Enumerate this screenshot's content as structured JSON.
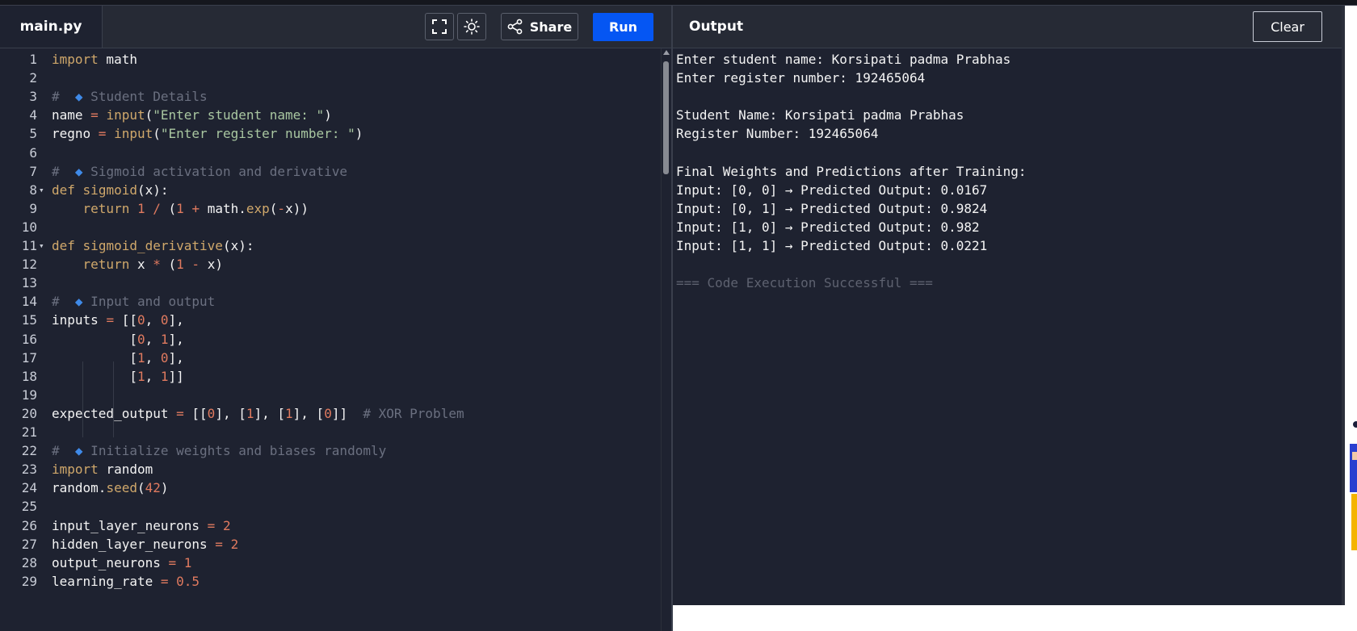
{
  "editor": {
    "file_tab": "main.py",
    "share_label": "Share",
    "run_label": "Run",
    "lines": [
      {
        "n": "1",
        "fold": "",
        "html": "<span class=\"kw\">import</span> math"
      },
      {
        "n": "2",
        "fold": "",
        "html": ""
      },
      {
        "n": "3",
        "fold": "",
        "html": "<span class=\"cm\">#  <span class=\"dia\">◆</span> Student Details</span>"
      },
      {
        "n": "4",
        "fold": "",
        "html": "name <span class=\"op\">=</span> <span class=\"fn\">input</span>(<span class=\"str\">\"Enter student name: \"</span>)"
      },
      {
        "n": "5",
        "fold": "",
        "html": "regno <span class=\"op\">=</span> <span class=\"fn\">input</span>(<span class=\"str\">\"Enter register number: \"</span>)"
      },
      {
        "n": "6",
        "fold": "",
        "html": ""
      },
      {
        "n": "7",
        "fold": "",
        "html": "<span class=\"cm\">#  <span class=\"dia\">◆</span> Sigmoid activation and derivative</span>"
      },
      {
        "n": "8",
        "fold": "▾",
        "html": "<span class=\"kw\">def</span> <span class=\"fn\">sigmoid</span>(x):"
      },
      {
        "n": "9",
        "fold": "",
        "html": "    <span class=\"kw\">return</span> <span class=\"num\">1</span> <span class=\"op\">/</span> (<span class=\"num\">1</span> <span class=\"op\">+</span> math.<span class=\"fn\">exp</span>(<span class=\"op\">-</span>x))"
      },
      {
        "n": "10",
        "fold": "",
        "html": ""
      },
      {
        "n": "11",
        "fold": "▾",
        "html": "<span class=\"kw\">def</span> <span class=\"fn\">sigmoid_derivative</span>(x):"
      },
      {
        "n": "12",
        "fold": "",
        "html": "    <span class=\"kw\">return</span> x <span class=\"op\">*</span> (<span class=\"num\">1</span> <span class=\"op\">-</span> x)"
      },
      {
        "n": "13",
        "fold": "",
        "html": ""
      },
      {
        "n": "14",
        "fold": "",
        "html": "<span class=\"cm\">#  <span class=\"dia\">◆</span> Input and output</span>"
      },
      {
        "n": "15",
        "fold": "",
        "html": "inputs <span class=\"op\">=</span> [[<span class=\"num\">0</span>, <span class=\"num\">0</span>],"
      },
      {
        "n": "16",
        "fold": "",
        "html": "          [<span class=\"num\">0</span>, <span class=\"num\">1</span>],"
      },
      {
        "n": "17",
        "fold": "",
        "html": "          [<span class=\"num\">1</span>, <span class=\"num\">0</span>],"
      },
      {
        "n": "18",
        "fold": "",
        "html": "          [<span class=\"num\">1</span>, <span class=\"num\">1</span>]]"
      },
      {
        "n": "19",
        "fold": "",
        "html": ""
      },
      {
        "n": "20",
        "fold": "",
        "html": "expected_output <span class=\"op\">=</span> [[<span class=\"num\">0</span>], [<span class=\"num\">1</span>], [<span class=\"num\">1</span>], [<span class=\"num\">0</span>]]  <span class=\"cm\"># XOR Problem</span>"
      },
      {
        "n": "21",
        "fold": "",
        "html": ""
      },
      {
        "n": "22",
        "fold": "",
        "html": "<span class=\"cm\">#  <span class=\"dia\">◆</span> Initialize weights and biases randomly</span>"
      },
      {
        "n": "23",
        "fold": "",
        "html": "<span class=\"kw\">import</span> random"
      },
      {
        "n": "24",
        "fold": "",
        "html": "random.<span class=\"fn\">seed</span>(<span class=\"num\">42</span>)"
      },
      {
        "n": "25",
        "fold": "",
        "html": ""
      },
      {
        "n": "26",
        "fold": "",
        "html": "input_layer_neurons <span class=\"op\">=</span> <span class=\"num\">2</span>"
      },
      {
        "n": "27",
        "fold": "",
        "html": "hidden_layer_neurons <span class=\"op\">=</span> <span class=\"num\">2</span>"
      },
      {
        "n": "28",
        "fold": "",
        "html": "output_neurons <span class=\"op\">=</span> <span class=\"num\">1</span>"
      },
      {
        "n": "29",
        "fold": "",
        "html": "learning_rate <span class=\"op\">=</span> <span class=\"num\">0.5</span>"
      }
    ]
  },
  "output": {
    "title": "Output",
    "clear_label": "Clear",
    "lines": [
      {
        "text": "Enter student name: Korsipati padma Prabhas",
        "muted": false
      },
      {
        "text": "Enter register number: 192465064",
        "muted": false
      },
      {
        "text": "",
        "muted": false
      },
      {
        "text": "Student Name: Korsipati padma Prabhas",
        "muted": false
      },
      {
        "text": "Register Number: 192465064",
        "muted": false
      },
      {
        "text": "",
        "muted": false
      },
      {
        "text": "Final Weights and Predictions after Training:",
        "muted": false
      },
      {
        "text": "Input: [0, 0] → Predicted Output: 0.0167",
        "muted": false
      },
      {
        "text": "Input: [0, 1] → Predicted Output: 0.9824",
        "muted": false
      },
      {
        "text": "Input: [1, 0] → Predicted Output: 0.982",
        "muted": false
      },
      {
        "text": "Input: [1, 1] → Predicted Output: 0.0221",
        "muted": false
      },
      {
        "text": "",
        "muted": false
      },
      {
        "text": "=== Code Execution Successful ===",
        "muted": true
      }
    ]
  },
  "icons": {
    "fullscreen": "fullscreen-icon",
    "theme": "sun-icon",
    "share": "share-icon"
  },
  "colors": {
    "run_button": "#0556f3",
    "background": "#1e2230",
    "keyword": "#d0a86b",
    "string": "#a9c7a1",
    "number": "#e07a5f",
    "comment": "#6b7080"
  }
}
